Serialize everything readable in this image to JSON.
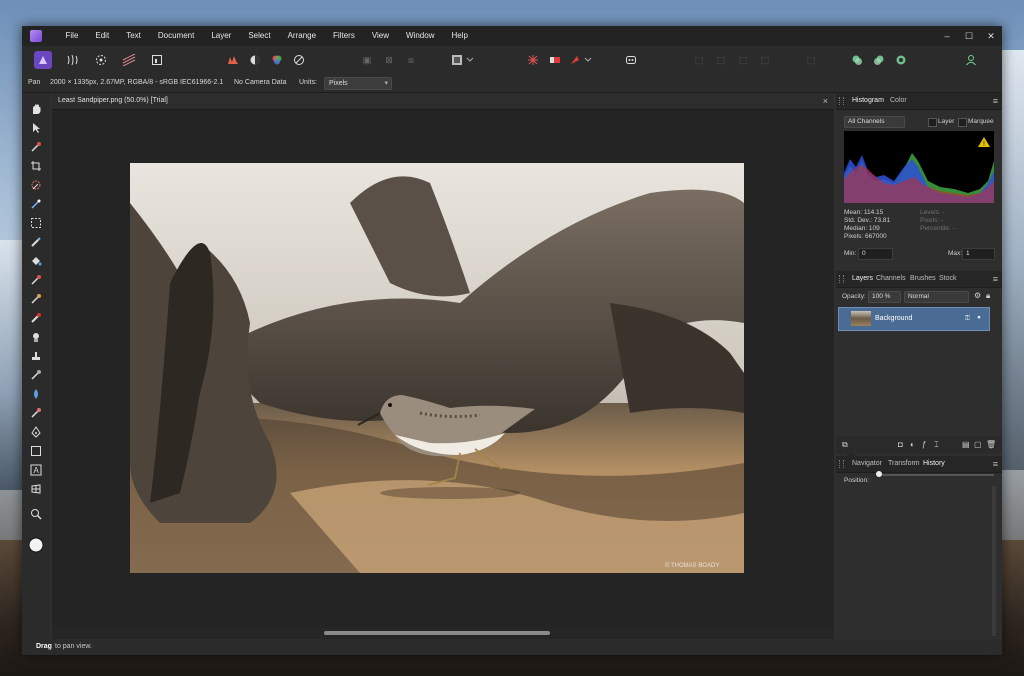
{
  "menu": [
    "File",
    "Edit",
    "Text",
    "Document",
    "Layer",
    "Select",
    "Arrange",
    "Filters",
    "View",
    "Window",
    "Help"
  ],
  "window_controls": {
    "minimize": "–",
    "maximize": "☐",
    "close": "✕"
  },
  "context": {
    "tool": "Pan",
    "doc_info": "2000 × 1335px, 2.67MP, RGBA/8 - sRGB IEC61966-2.1",
    "camera": "No Camera Data",
    "units_label": "Units:",
    "units_value": "Pixels"
  },
  "document": {
    "tab_title": "Least Sandpiper.png (50.0%) [Trial]",
    "close": "×",
    "watermark": "© THOMAS BOADY"
  },
  "histogram_panel": {
    "tabs": [
      "Histogram",
      "Color"
    ],
    "channel": "All Channels",
    "layer_label": "Layer",
    "marquee_label": "Marquee",
    "stats_left": [
      "Mean: 114.15",
      "Std. Dev.: 73.81",
      "Median: 109",
      "Pixels: 667000"
    ],
    "stats_right": [
      "Levels: -",
      "Pixels: -",
      "Percentile: -"
    ],
    "min_label": "Min:",
    "min_value": "0",
    "max_label": "Max:",
    "max_value": "1",
    "warning": "!"
  },
  "layers_panel": {
    "tabs": [
      "Layers",
      "Channels",
      "Brushes",
      "Stock"
    ],
    "opacity_label": "Opacity:",
    "opacity_value": "100 %",
    "blend_mode": "Normal",
    "layer_name": "Background"
  },
  "history_panel": {
    "tabs": [
      "Navigator",
      "Transform",
      "History"
    ],
    "position_label": "Position:",
    "position_value": 0
  },
  "status": {
    "bold": "Drag",
    "text": " to pan view."
  },
  "icons": {
    "toolbar": [
      "persona-photo-icon",
      "persona-liquify-icon",
      "persona-develop-icon",
      "persona-tonemap-icon",
      "persona-export-icon",
      "auto-levels-icon",
      "auto-contrast-icon",
      "auto-colors-icon",
      "auto-wb-icon",
      "mask-icon",
      "order-icon",
      "align-icon",
      "selection-mode-icon",
      "snapping-icon",
      "assistant-icon",
      "user-icon"
    ],
    "tools": [
      "view-tool",
      "move-tool",
      "color-picker",
      "crop-tool",
      "selection-brush",
      "flood-select",
      "marquee",
      "paint-brush",
      "fill",
      "brush",
      "healing",
      "clone",
      "dodge",
      "blur",
      "inpaint",
      "smudge",
      "pen",
      "shape",
      "text",
      "mesh",
      "zoom"
    ]
  },
  "colors": {
    "accent": "#4a6b93",
    "window_bg": "#303030",
    "canvas_bg": "#242424"
  }
}
